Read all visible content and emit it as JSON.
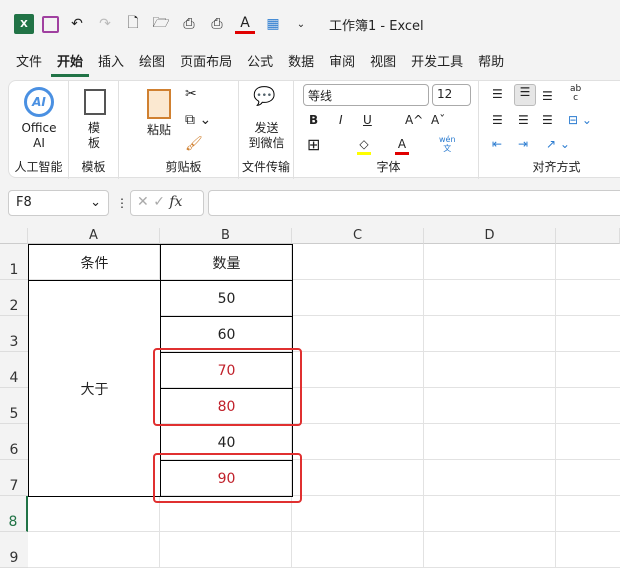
{
  "title": "工作簿1  -  Excel",
  "qat": {
    "app_icon": "excel-icon",
    "save": "save-icon",
    "undo": "undo-icon",
    "redo": "redo-icon",
    "new": "new-file-icon",
    "open": "open-folder-icon",
    "print_preview": "print-preview-icon",
    "print": "print-icon",
    "font_color": "A",
    "table": "table-icon",
    "customize": "customize-icon"
  },
  "menu": [
    "文件",
    "开始",
    "插入",
    "绘图",
    "页面布局",
    "公式",
    "数据",
    "审阅",
    "视图",
    "开发工具",
    "帮助"
  ],
  "ribbon": {
    "ai": {
      "label": "Office\nAI",
      "badge": "AI",
      "group": "人工智能"
    },
    "template": {
      "label": "模\n板",
      "group": "模板"
    },
    "clipboard": {
      "paste": "粘贴",
      "group": "剪贴板"
    },
    "transfer": {
      "label": "发送\n到微信",
      "group": "文件传输"
    },
    "font": {
      "name": "等线",
      "size": "12",
      "bold": "B",
      "italic": "I",
      "underline": "U",
      "grow": "A^",
      "shrink": "Aˇ",
      "font_color": "A",
      "phonetic": "wén\n文",
      "group": "字体",
      "fill_color": "#ffff00",
      "text_color": "#e00000"
    },
    "align": {
      "group": "对齐方式",
      "wrap": "ab\nc"
    }
  },
  "formula_bar": {
    "name_box": "F8",
    "fx": "fx",
    "value": ""
  },
  "columns": [
    "A",
    "B",
    "C",
    "D"
  ],
  "rows": [
    "1",
    "2",
    "3",
    "4",
    "5",
    "6",
    "7",
    "8",
    "9"
  ],
  "cells": {
    "A1": "条件",
    "B1": "数量",
    "A2": "大于",
    "B2": "50",
    "B3": "60",
    "B4": "70",
    "B5": "80",
    "B6": "40",
    "B7": "90"
  },
  "colors": {
    "highlight_text": "#c0202a",
    "highlight_box": "#e03030",
    "accent": "#217346"
  }
}
